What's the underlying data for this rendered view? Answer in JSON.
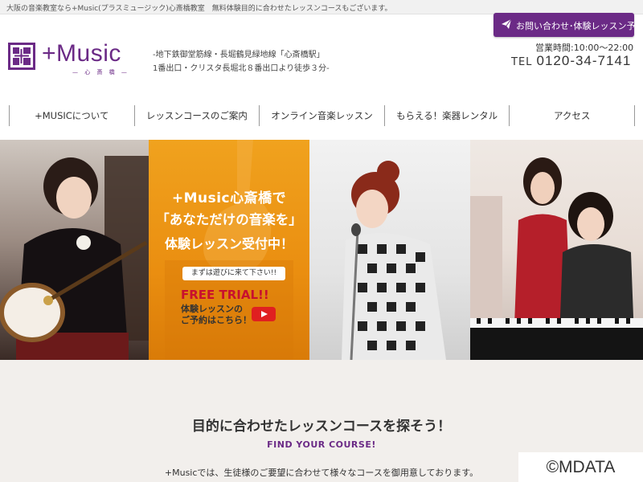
{
  "topbar": {
    "tagline": "大阪の音楽教室なら+Music(プラスミュージック)心斎橋教室　無料体験目的に合わせたレッスンコースもございます。"
  },
  "header": {
    "contact_button": "お問い合わせ･体験レッスン予約",
    "logo_word": "+Music",
    "logo_sub": "— 心 斎 橋 —",
    "address_line1": "-地下鉄御堂筋線・長堀鶴見緑地線「心斎橋駅」",
    "address_line2": "1番出口・クリスタ長堀北８番出口より徒歩３分-",
    "hours": "営業時間:10:00〜22:00",
    "tel_label": "TEL",
    "tel_number": "0120-34-7141"
  },
  "nav": {
    "items": [
      {
        "label": "+MUSICについて"
      },
      {
        "label": "レッスンコースのご案内"
      },
      {
        "label": "オンライン音楽レッスン"
      },
      {
        "label": "もらえる！楽器レンタル"
      },
      {
        "label": "アクセス"
      }
    ]
  },
  "hero": {
    "line1": "+Music心斎橋で",
    "line2": "「あなただけの音楽を」",
    "line3": "体験レッスン受付中！",
    "pill": "まずは遊びに来て下さい!!",
    "free": "FREE TRIAL!!",
    "note1": "体験レッスンの",
    "note2": "ご予約はこちら！"
  },
  "section": {
    "title": "目的に合わせたレッスンコースを探そう！",
    "subtitle": "FIND YOUR COURSE!",
    "description": "+Musicでは、生徒様のご要望に合わせて様々なコースを御用意しております。"
  },
  "watermark": "©MDATA",
  "colors": {
    "brand": "#6b2a86",
    "hero_orange": "#ea8e10",
    "free_red": "#c8102e"
  },
  "icons": {
    "contact": "send-icon",
    "logo": "plus-music-mark-icon",
    "video": "play-icon"
  }
}
